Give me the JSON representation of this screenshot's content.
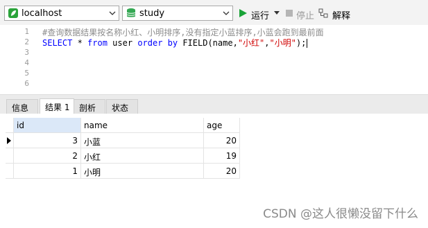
{
  "toolbar": {
    "connection": {
      "value": "localhost",
      "icon": "connection-leaf-icon",
      "color": "#2aa33a"
    },
    "database": {
      "value": "study",
      "icon": "database-icon",
      "color": "#34a853"
    },
    "run_label": "运行",
    "stop_label": "停止",
    "explain_label": "解释"
  },
  "editor": {
    "lines": [
      {
        "n": "1",
        "text": "#查询数据结果按名称小红、小明排序,没有指定小蓝排序,小蓝会跑到最前面"
      },
      {
        "n": "2"
      },
      {
        "n": "3"
      },
      {
        "n": "4"
      },
      {
        "n": "5"
      },
      {
        "n": "6"
      }
    ],
    "sql": {
      "select": "SELECT",
      "star": " * ",
      "from": "from",
      "table": " user ",
      "order_by": "order by",
      "func": " FIELD(name,",
      "arg1": "\"小红\"",
      "comma": ",",
      "arg2": "\"小明\"",
      "end": ");"
    }
  },
  "tabs": [
    {
      "label": "信息",
      "active": false
    },
    {
      "label": "结果 1",
      "active": true
    },
    {
      "label": "剖析",
      "active": false
    },
    {
      "label": "状态",
      "active": false
    }
  ],
  "grid": {
    "columns": [
      "id",
      "name",
      "age"
    ],
    "rows": [
      {
        "id": "3",
        "name": "小蓝",
        "age": "20"
      },
      {
        "id": "2",
        "name": "小红",
        "age": "19"
      },
      {
        "id": "1",
        "name": "小明",
        "age": "20"
      }
    ]
  },
  "watermark": "CSDN @这人很懒没留下什么"
}
